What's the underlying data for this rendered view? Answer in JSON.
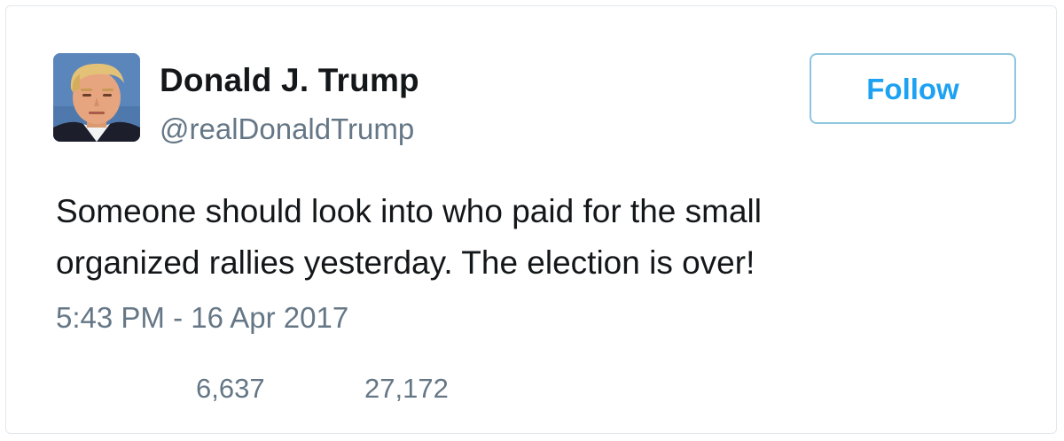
{
  "tweet": {
    "author_name": "Donald J. Trump",
    "author_handle": "@realDonaldTrump",
    "follow_label": "Follow",
    "text_lines": [
      "Someone should look into who paid for the small",
      "organized rallies yesterday. The election is over!"
    ],
    "timestamp": "5:43 PM - 16 Apr 2017",
    "retweet_count": "6,637",
    "like_count": "27,172"
  },
  "colors": {
    "accent": "#1da1f2",
    "secondary_text": "#657786",
    "primary_text": "#14171a",
    "border": "#e1e8ed"
  }
}
